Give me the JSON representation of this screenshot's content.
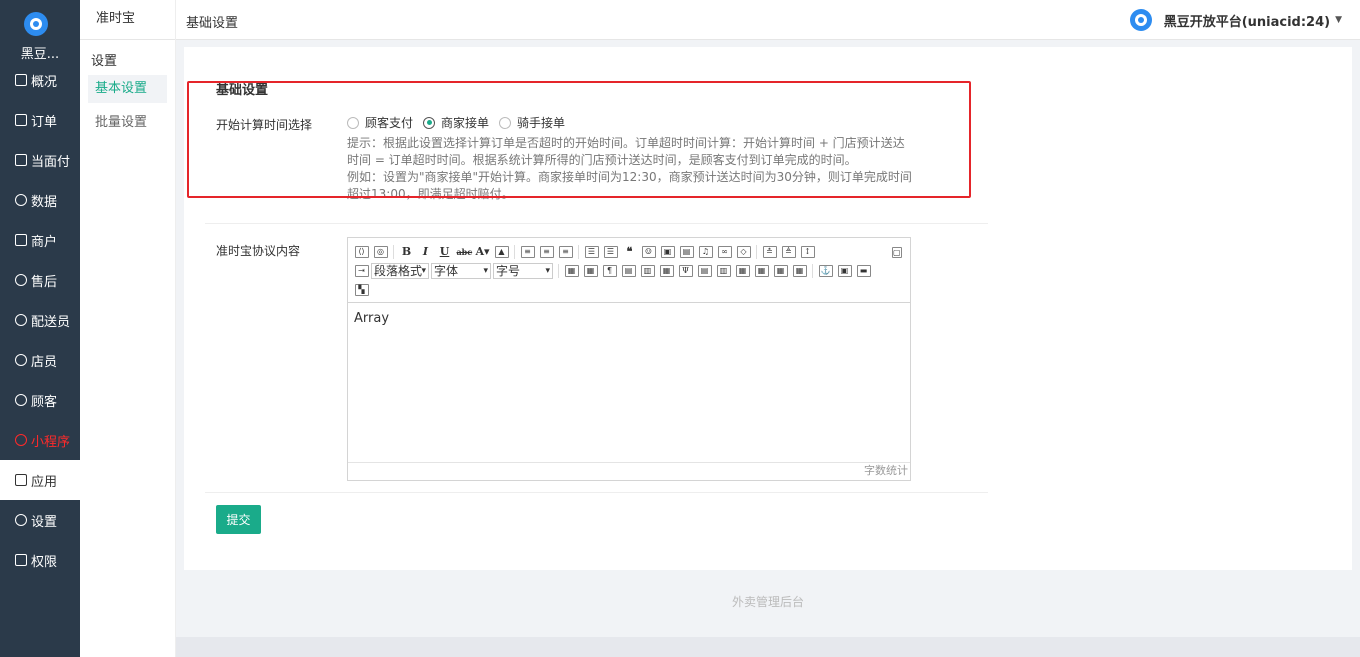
{
  "sidebar": {
    "brand": "黑豆...",
    "items": [
      {
        "label": "概况",
        "icon": "calendar-icon"
      },
      {
        "label": "订单",
        "icon": "list-icon"
      },
      {
        "label": "当面付",
        "icon": "list-icon"
      },
      {
        "label": "数据",
        "icon": "chart-icon"
      },
      {
        "label": "商户",
        "icon": "store-icon"
      },
      {
        "label": "售后",
        "icon": "service-icon"
      },
      {
        "label": "配送员",
        "icon": "user-icon"
      },
      {
        "label": "店员",
        "icon": "user-icon"
      },
      {
        "label": "顾客",
        "icon": "user-icon"
      },
      {
        "label": "小程序",
        "icon": "miniapp-icon"
      },
      {
        "label": "应用",
        "icon": "apps-icon"
      },
      {
        "label": "设置",
        "icon": "gear-icon"
      },
      {
        "label": "权限",
        "icon": "lock-icon"
      }
    ],
    "highlight_color": "#ff2a2a"
  },
  "subnav": {
    "title": "准时宝",
    "group": "设置",
    "links": [
      "基本设置",
      "批量设置"
    ]
  },
  "topbar": {
    "breadcrumb": "基础设置",
    "user": "黑豆开放平台(uniacid:24)"
  },
  "form": {
    "section_title": "基础设置",
    "start_time_label": "开始计算时间选择",
    "options": [
      "顾客支付",
      "商家接单",
      "骑手接单"
    ],
    "selected_option": "商家接单",
    "hint_line1": "提示：根据此设置选择计算订单是否超时的开始时间。订单超时时间计算：开始计算时间 + 门店预计送达时间 = 订单超时时间。根据系统计算所得的门店预计送达时间，是顾客支付到订单完成的时间。",
    "hint_line2": "例如：设置为\"商家接单\"开始计算。商家接单时间为12:30，商家预计送达时间为30分钟，则订单完成时间超过13:00，即满足超时赔付。",
    "agreement_label": "准时宝协议内容",
    "editor_content": "Array",
    "editor_word_count": "字数统计",
    "select_paragraph": "段落格式",
    "select_font": "字体",
    "select_size": "字号",
    "submit_label": "提交"
  },
  "footer": {
    "text": "外卖管理后台"
  },
  "colors": {
    "sidebar_bg": "#2b3a4a",
    "accent": "#1aab8a",
    "annotation_box": "#e5252a"
  }
}
